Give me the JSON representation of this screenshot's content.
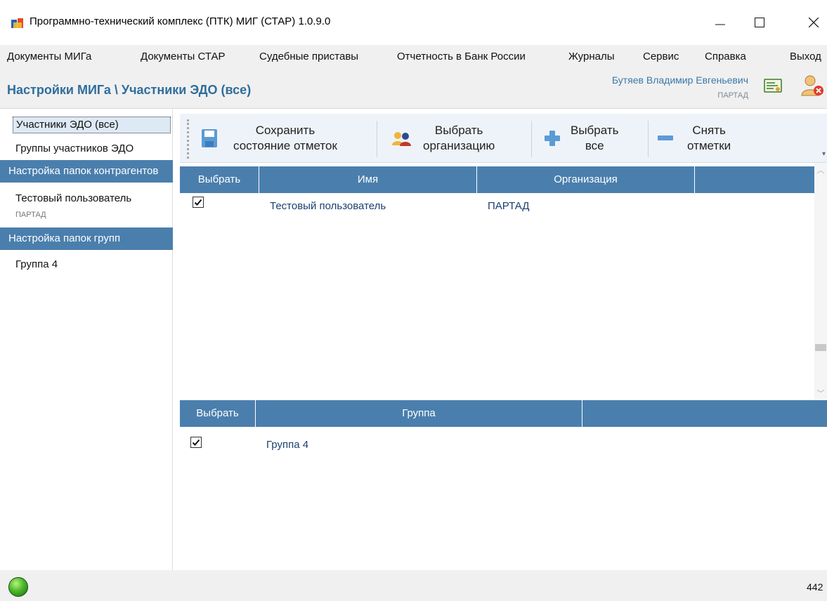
{
  "window": {
    "title": "Программно-технический комплекс (ПТК) МИГ (СТАР) 1.0.9.0"
  },
  "menu": [
    "Документы МИГа",
    "Документы СТАР",
    "Судебные приставы",
    "Отчетность в Банк России",
    "Журналы",
    "Сервис",
    "Справка",
    "Выход"
  ],
  "header": {
    "title": "Настройки МИГа \\ Участники ЭДО (все)",
    "user_name": "Бутяев Владимир Евгеньевич",
    "user_org": "ПАРТАД"
  },
  "sidebar": {
    "items": [
      {
        "label": "Участники ЭДО (все)"
      },
      {
        "label": "Группы участников ЭДО"
      }
    ],
    "section_contractors": "Настройка папок контрагентов",
    "contractor": {
      "label": "Тестовый пользователь",
      "sub": "ПАРТАД"
    },
    "section_groups": "Настройка папок групп",
    "group": {
      "label": "Группа 4"
    }
  },
  "toolbar": {
    "save_label": "Сохранить\nсостояние отметок",
    "select_org_label": "Выбрать\nорганизацию",
    "select_all_label": "Выбрать\nвсе",
    "clear_label": "Снять\nотметки"
  },
  "participants_grid": {
    "columns": [
      "Выбрать",
      "Имя",
      "Организация"
    ],
    "rows": [
      {
        "checked": true,
        "name": "Тестовый пользователь",
        "org": "ПАРТАД"
      }
    ]
  },
  "groups_grid": {
    "columns": [
      "Выбрать",
      "Группа"
    ],
    "rows": [
      {
        "checked": true,
        "group": "Группа 4"
      }
    ]
  },
  "status": {
    "number": "442"
  },
  "colors": {
    "accent": "#4a7fad",
    "title_blue": "#2e6e9c",
    "status_green": "#4bb82a"
  }
}
